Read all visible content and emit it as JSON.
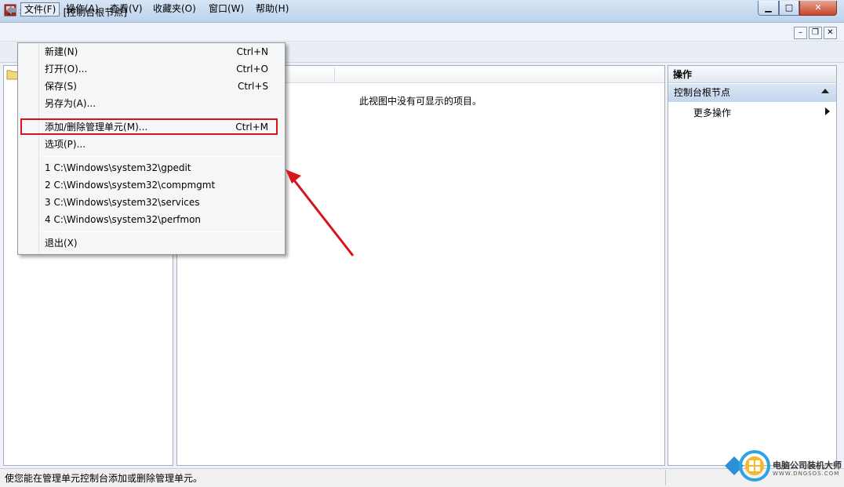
{
  "window": {
    "title": "控制台1 - [控制台根节点]",
    "min_glyph": "▁",
    "max_glyph": "□",
    "close_glyph": "✕"
  },
  "menubar": {
    "file": "文件(F)",
    "action": "操作(A)",
    "view": "查看(V)",
    "favorites": "收藏夹(O)",
    "window": "窗口(W)",
    "help": "帮助(H)"
  },
  "mdi": {
    "min": "–",
    "restore": "❐",
    "close": "✕"
  },
  "file_menu": {
    "items": [
      {
        "label": "新建(N)",
        "shortcut": "Ctrl+N"
      },
      {
        "label": "打开(O)...",
        "shortcut": "Ctrl+O"
      },
      {
        "label": "保存(S)",
        "shortcut": "Ctrl+S"
      },
      {
        "label": "另存为(A)...",
        "shortcut": ""
      },
      {
        "label": "添加/删除管理单元(M)...",
        "shortcut": "Ctrl+M"
      },
      {
        "label": "选项(P)...",
        "shortcut": ""
      },
      {
        "label": "1 C:\\Windows\\system32\\gpedit",
        "shortcut": ""
      },
      {
        "label": "2 C:\\Windows\\system32\\compmgmt",
        "shortcut": ""
      },
      {
        "label": "3 C:\\Windows\\system32\\services",
        "shortcut": ""
      },
      {
        "label": "4 C:\\Windows\\system32\\perfmon",
        "shortcut": ""
      },
      {
        "label": "退出(X)",
        "shortcut": ""
      }
    ]
  },
  "center": {
    "empty_message": "此视图中没有可显示的项目。"
  },
  "actions": {
    "header": "操作",
    "group": "控制台根节点",
    "more": "更多操作"
  },
  "status": {
    "text": "使您能在管理单元控制台添加或删除管理单元。"
  },
  "watermark": {
    "title": "电脑公司装机大师",
    "subtitle": "WWW.DNGSOS.COM"
  },
  "colors": {
    "highlight_border": "#d7141a",
    "arrow": "#d7141a",
    "title_bar": "#c8dbf1"
  }
}
